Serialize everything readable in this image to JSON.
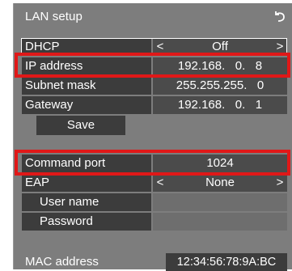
{
  "title": "LAN setup",
  "back_icon": "return-arrow-icon",
  "rows": {
    "dhcp": {
      "label": "DHCP",
      "value": "Off"
    },
    "ip": {
      "label": "IP address",
      "value": "192.168.   0.   8"
    },
    "subnet": {
      "label": "Subnet mask",
      "value": "255.255.255.   0"
    },
    "gateway": {
      "label": "Gateway",
      "value": "192.168.   0.   1"
    },
    "command_port": {
      "label": "Command port",
      "value": "1024"
    },
    "eap": {
      "label": "EAP",
      "value": "None"
    },
    "user_name": {
      "label": "User name",
      "value": ""
    },
    "password": {
      "label": "Password",
      "value": ""
    }
  },
  "arrows": {
    "left": "<",
    "right": ">"
  },
  "save_label": "Save",
  "mac": {
    "label": "MAC address",
    "value": "12:34:56:78:9A:BC"
  },
  "colors": {
    "panel": "#7d7d7d",
    "label_bg": "#3c3c3c",
    "value_bg": "#4b4b4b",
    "highlight": "#e01818"
  }
}
